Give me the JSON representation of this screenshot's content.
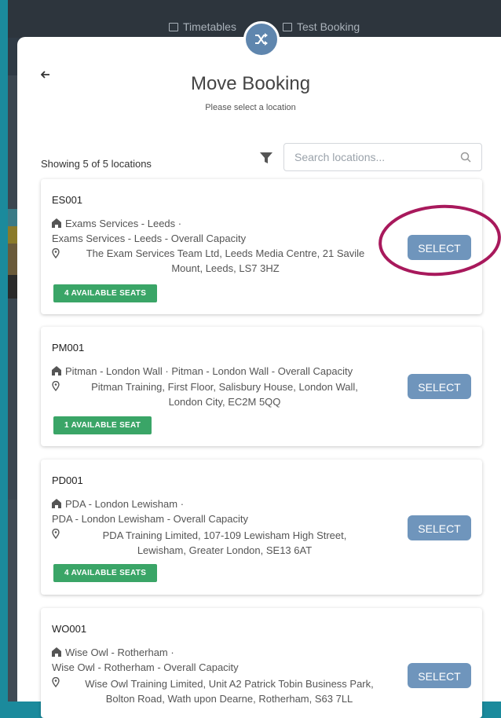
{
  "nav": {
    "tabs": [
      {
        "label": "Timetables"
      },
      {
        "label": "Test Booking"
      }
    ]
  },
  "dialog": {
    "title": "Move Booking",
    "subtitle": "Please select a location",
    "back_icon": "arrow-left-icon",
    "shuffle_icon": "shuffle-icon"
  },
  "toolbar": {
    "showing": "Showing 5 of 5 locations",
    "search_placeholder": "Search locations...",
    "filter_icon": "filter-icon",
    "search_icon": "search-icon"
  },
  "select_label": "SELECT",
  "locations": [
    {
      "code": "ES001",
      "name_line1": "Exams Services - Leeds ·",
      "name_line2": "Exams Services - Leeds - Overall Capacity",
      "address_line1": "The Exam Services Team Ltd, Leeds Media Centre, 21 Savile",
      "address_line2": "Mount, Leeds, LS7 3HZ",
      "seats": "4 AVAILABLE SEATS"
    },
    {
      "code": "PM001",
      "name_line1": "Pitman - London Wall · Pitman - London Wall - Overall Capacity",
      "address_line1": "Pitman Training, First Floor, Salisbury House, London Wall,",
      "address_line2": "London City, EC2M 5QQ",
      "seats": "1 AVAILABLE SEAT"
    },
    {
      "code": "PD001",
      "name_line1": "PDA - London Lewisham ·",
      "name_line2": "PDA - London Lewisham - Overall Capacity",
      "address_line1": "PDA Training Limited, 107-109 Lewisham High Street,",
      "address_line2": "Lewisham, Greater London, SE13 6AT",
      "seats": "4 AVAILABLE SEATS"
    },
    {
      "code": "WO001",
      "name_line1": "Wise Owl - Rotherham ·",
      "name_line2": "Wise Owl - Rotherham - Overall Capacity",
      "address_line1": "Wise Owl Training Limited, Unit A2 Patrick Tobin Business Park,",
      "address_line2": "Bolton Road, Wath upon Dearne, Rotherham, S63 7LL"
    }
  ],
  "colors": {
    "accent": "#6f95bc",
    "seats_badge": "#3aa567",
    "highlight_ring": "#a8195c"
  }
}
